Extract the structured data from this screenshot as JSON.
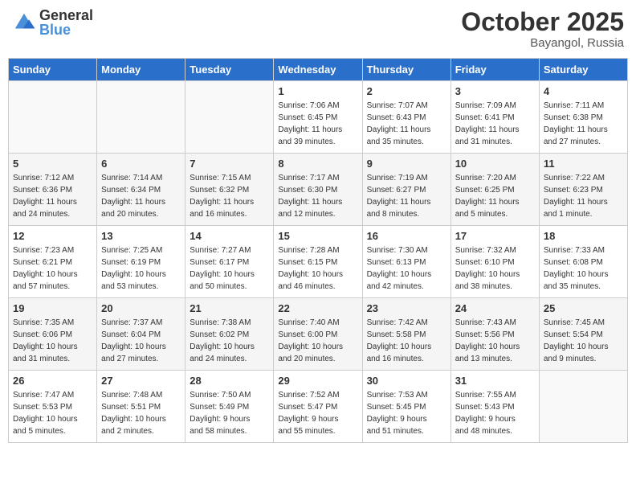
{
  "header": {
    "logo_general": "General",
    "logo_blue": "Blue",
    "month": "October 2025",
    "location": "Bayangol, Russia"
  },
  "days_of_week": [
    "Sunday",
    "Monday",
    "Tuesday",
    "Wednesday",
    "Thursday",
    "Friday",
    "Saturday"
  ],
  "weeks": [
    [
      {
        "day": "",
        "info": ""
      },
      {
        "day": "",
        "info": ""
      },
      {
        "day": "",
        "info": ""
      },
      {
        "day": "1",
        "info": "Sunrise: 7:06 AM\nSunset: 6:45 PM\nDaylight: 11 hours\nand 39 minutes."
      },
      {
        "day": "2",
        "info": "Sunrise: 7:07 AM\nSunset: 6:43 PM\nDaylight: 11 hours\nand 35 minutes."
      },
      {
        "day": "3",
        "info": "Sunrise: 7:09 AM\nSunset: 6:41 PM\nDaylight: 11 hours\nand 31 minutes."
      },
      {
        "day": "4",
        "info": "Sunrise: 7:11 AM\nSunset: 6:38 PM\nDaylight: 11 hours\nand 27 minutes."
      }
    ],
    [
      {
        "day": "5",
        "info": "Sunrise: 7:12 AM\nSunset: 6:36 PM\nDaylight: 11 hours\nand 24 minutes."
      },
      {
        "day": "6",
        "info": "Sunrise: 7:14 AM\nSunset: 6:34 PM\nDaylight: 11 hours\nand 20 minutes."
      },
      {
        "day": "7",
        "info": "Sunrise: 7:15 AM\nSunset: 6:32 PM\nDaylight: 11 hours\nand 16 minutes."
      },
      {
        "day": "8",
        "info": "Sunrise: 7:17 AM\nSunset: 6:30 PM\nDaylight: 11 hours\nand 12 minutes."
      },
      {
        "day": "9",
        "info": "Sunrise: 7:19 AM\nSunset: 6:27 PM\nDaylight: 11 hours\nand 8 minutes."
      },
      {
        "day": "10",
        "info": "Sunrise: 7:20 AM\nSunset: 6:25 PM\nDaylight: 11 hours\nand 5 minutes."
      },
      {
        "day": "11",
        "info": "Sunrise: 7:22 AM\nSunset: 6:23 PM\nDaylight: 11 hours\nand 1 minute."
      }
    ],
    [
      {
        "day": "12",
        "info": "Sunrise: 7:23 AM\nSunset: 6:21 PM\nDaylight: 10 hours\nand 57 minutes."
      },
      {
        "day": "13",
        "info": "Sunrise: 7:25 AM\nSunset: 6:19 PM\nDaylight: 10 hours\nand 53 minutes."
      },
      {
        "day": "14",
        "info": "Sunrise: 7:27 AM\nSunset: 6:17 PM\nDaylight: 10 hours\nand 50 minutes."
      },
      {
        "day": "15",
        "info": "Sunrise: 7:28 AM\nSunset: 6:15 PM\nDaylight: 10 hours\nand 46 minutes."
      },
      {
        "day": "16",
        "info": "Sunrise: 7:30 AM\nSunset: 6:13 PM\nDaylight: 10 hours\nand 42 minutes."
      },
      {
        "day": "17",
        "info": "Sunrise: 7:32 AM\nSunset: 6:10 PM\nDaylight: 10 hours\nand 38 minutes."
      },
      {
        "day": "18",
        "info": "Sunrise: 7:33 AM\nSunset: 6:08 PM\nDaylight: 10 hours\nand 35 minutes."
      }
    ],
    [
      {
        "day": "19",
        "info": "Sunrise: 7:35 AM\nSunset: 6:06 PM\nDaylight: 10 hours\nand 31 minutes."
      },
      {
        "day": "20",
        "info": "Sunrise: 7:37 AM\nSunset: 6:04 PM\nDaylight: 10 hours\nand 27 minutes."
      },
      {
        "day": "21",
        "info": "Sunrise: 7:38 AM\nSunset: 6:02 PM\nDaylight: 10 hours\nand 24 minutes."
      },
      {
        "day": "22",
        "info": "Sunrise: 7:40 AM\nSunset: 6:00 PM\nDaylight: 10 hours\nand 20 minutes."
      },
      {
        "day": "23",
        "info": "Sunrise: 7:42 AM\nSunset: 5:58 PM\nDaylight: 10 hours\nand 16 minutes."
      },
      {
        "day": "24",
        "info": "Sunrise: 7:43 AM\nSunset: 5:56 PM\nDaylight: 10 hours\nand 13 minutes."
      },
      {
        "day": "25",
        "info": "Sunrise: 7:45 AM\nSunset: 5:54 PM\nDaylight: 10 hours\nand 9 minutes."
      }
    ],
    [
      {
        "day": "26",
        "info": "Sunrise: 7:47 AM\nSunset: 5:53 PM\nDaylight: 10 hours\nand 5 minutes."
      },
      {
        "day": "27",
        "info": "Sunrise: 7:48 AM\nSunset: 5:51 PM\nDaylight: 10 hours\nand 2 minutes."
      },
      {
        "day": "28",
        "info": "Sunrise: 7:50 AM\nSunset: 5:49 PM\nDaylight: 9 hours\nand 58 minutes."
      },
      {
        "day": "29",
        "info": "Sunrise: 7:52 AM\nSunset: 5:47 PM\nDaylight: 9 hours\nand 55 minutes."
      },
      {
        "day": "30",
        "info": "Sunrise: 7:53 AM\nSunset: 5:45 PM\nDaylight: 9 hours\nand 51 minutes."
      },
      {
        "day": "31",
        "info": "Sunrise: 7:55 AM\nSunset: 5:43 PM\nDaylight: 9 hours\nand 48 minutes."
      },
      {
        "day": "",
        "info": ""
      }
    ]
  ]
}
